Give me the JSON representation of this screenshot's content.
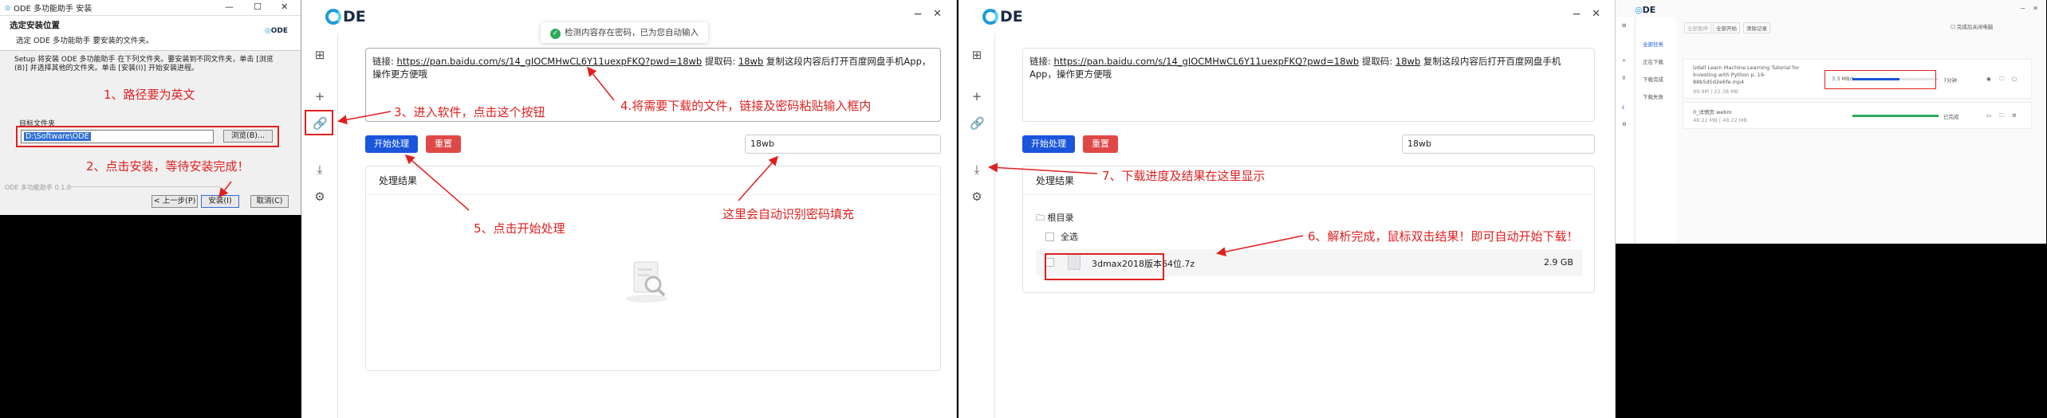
{
  "installer": {
    "title": "ODE 多功能助手 安装",
    "header_title": "选定安装位置",
    "header_sub": "选定 ODE 多功能助手 要安装的文件夹。",
    "logo": "ODE",
    "desc1": "Setup 将安装 ODE 多功能助手 在下列文件夹。要安装到不同文件夹，单击 [浏览",
    "desc2": "(B)] 并选择其他的文件夹。单击 [安装(I)] 开始安装进程。",
    "group_label": "目标文件夹",
    "path_value": "D:\\Software\\ODE",
    "browse": "浏览(B)...",
    "version": "ODE 多功能助手 0.1.0",
    "back": "< 上一步(P)",
    "install": "安装(I)",
    "cancel": "取消(C)",
    "step1": "1、路径要为英文",
    "step2": "2、点击安装，等待安装完成！"
  },
  "app": {
    "logo": "DE",
    "toast": "检测内容存在密码，已为您自动输入",
    "link_text_prefix": "链接: ",
    "link_url": "https://pan.baidu.com/s/14_gIOCMHwCL6Y11uexpFKQ?pwd=18wb",
    "link_mid": " 提取码: ",
    "link_code": "18wb",
    "link_suffix": " 复制这段内容后打开百度网盘手机App，操作更方便哦",
    "start_btn": "开始处理",
    "reset_btn": "重置",
    "pwd_value": "18wb",
    "result_title": "处理结果",
    "root_dir": "根目录",
    "select_all": "全选",
    "file_name": "3dmax2018版本64位.7z",
    "file_size": "2.9 GB",
    "step3": "3、进入软件，点击这个按钮",
    "step4": "4.将需要下载的文件，链接及密码粘贴输入框内",
    "step5": "5、点击开始处理",
    "step_auto": "这里会自动识别密码填充",
    "step6": "6、解析完成，鼠标双击结果！即可自动开始下载！",
    "step7": "7、下载进度及结果在这里显示"
  },
  "download": {
    "logo": "DE",
    "nav_all": "全部任务",
    "nav_downloading": "正在下载",
    "nav_done": "下载完成",
    "nav_failed": "下载失败",
    "tool_pause": "全部暂停",
    "tool_start": "全部开始",
    "tool_clear": "清除记录",
    "check_shutdown": "完成后关闭电脑",
    "item1_name": "Udall Learn Machine Learning Tutorial for",
    "item1_name2": "Investing with Python p. 19-",
    "item1_name3": "88b5d5d2e6fe.mp4",
    "item1_meta": "99.9M | 22.38 MB",
    "item1_speed": "3.3 MB/s",
    "item1_eta": "7分钟",
    "item1_progress": 0.55,
    "item2_name": "0_详情页.webm",
    "item2_meta": "48.22 MB | 48.22 MB",
    "item2_state": "已完成",
    "item2_progress": 1.0
  },
  "colors": {
    "accent": "#1a56db",
    "danger": "#e04848",
    "annot": "#e02020"
  }
}
